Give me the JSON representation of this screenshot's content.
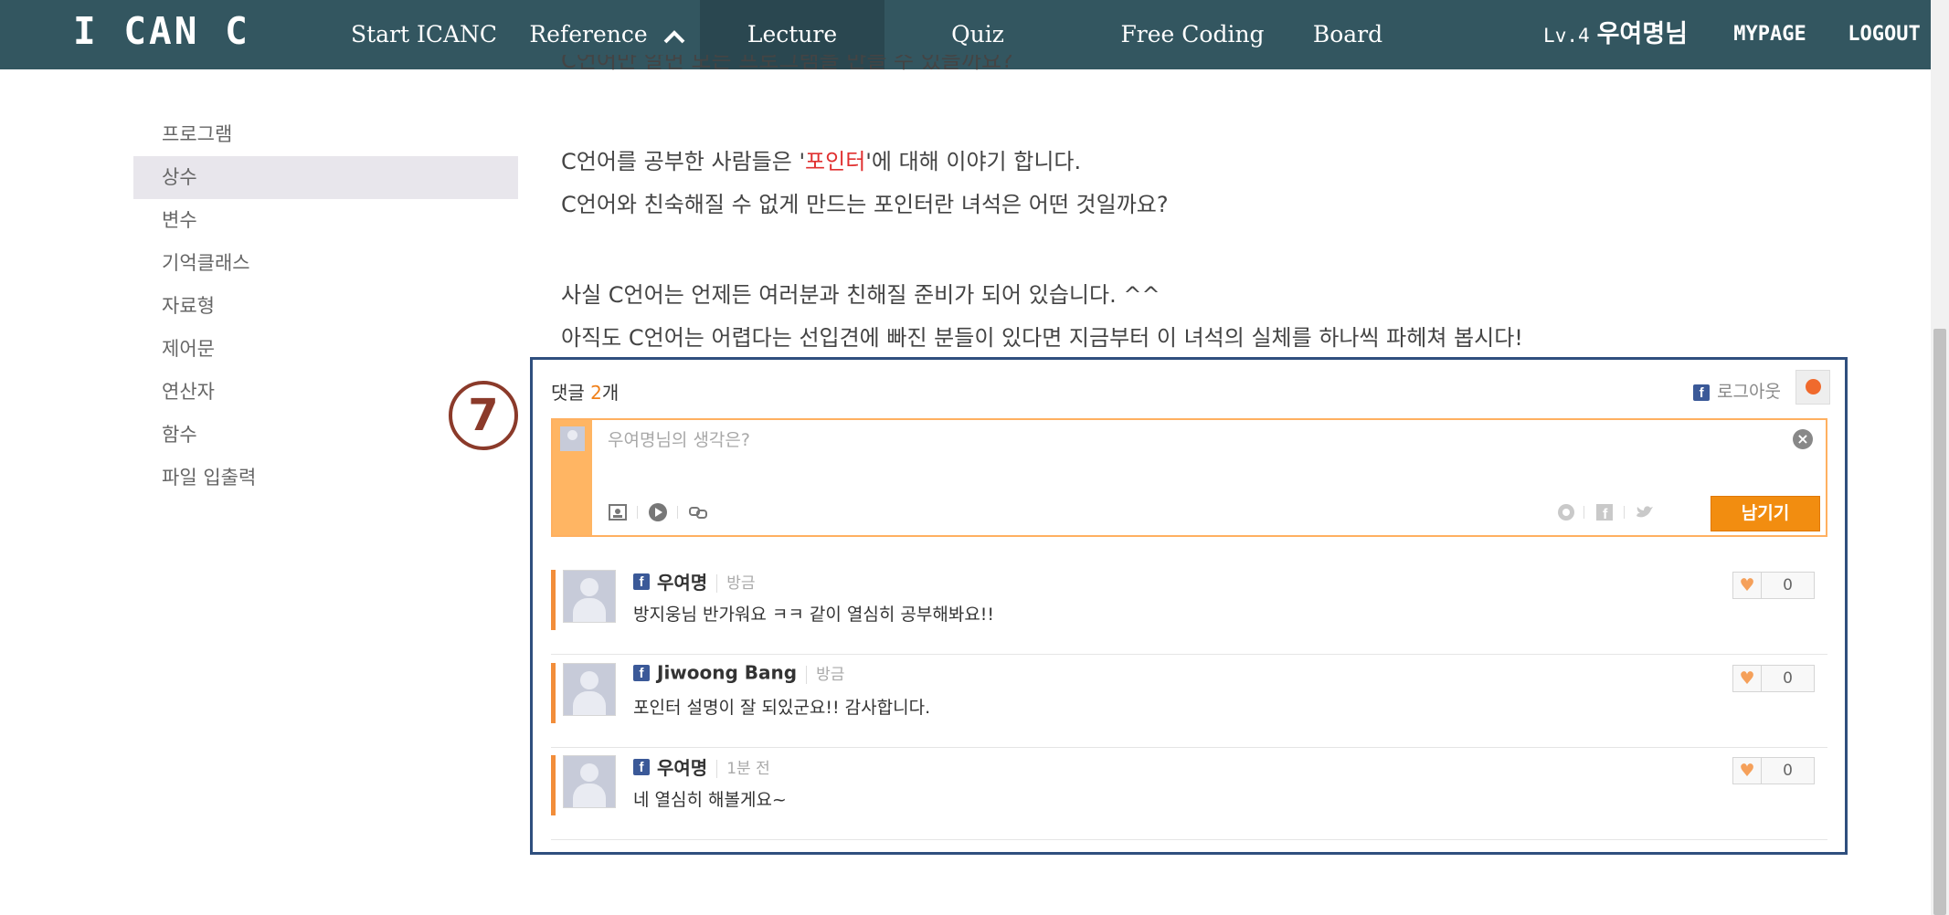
{
  "nav": {
    "logo": "I CAN C",
    "items": [
      {
        "label": "Start ICANC"
      },
      {
        "label": "Reference"
      },
      {
        "label": "Lecture"
      },
      {
        "label": "Quiz"
      },
      {
        "label": "Free Coding"
      },
      {
        "label": "Board"
      }
    ],
    "level": "Lv.4",
    "user": "우여명님",
    "mypage": "MYPAGE",
    "logout": "LOGOUT"
  },
  "sidebar": {
    "items": [
      {
        "label": "프로그램"
      },
      {
        "label": "상수"
      },
      {
        "label": "변수"
      },
      {
        "label": "기억클래스"
      },
      {
        "label": "자료형"
      },
      {
        "label": "제어문"
      },
      {
        "label": "연산자"
      },
      {
        "label": "함수"
      },
      {
        "label": "파일 입출력"
      }
    ],
    "active_index": 1
  },
  "article": {
    "line0": "C언어만 알면 모든 프로그램을 만들 수 있을까요?",
    "line1_pre": "C언어를 공부한 사람들은 '",
    "line1_hl": "포인터",
    "line1_post": "'에 대해 이야기 합니다.",
    "line2": "C언어와 친숙해질 수 없게 만드는 포인터란 녀석은 어떤 것일까요?",
    "line3": "사실 C언어는 언제든 여러분과 친해질 준비가 되어 있습니다. ^^",
    "line4": "아직도 C언어는 어렵다는 선입견에 빠진 분들이 있다면 지금부터 이 녀석의 실체를 하나씩 파헤쳐 봅시다!"
  },
  "annotation": "7",
  "comments": {
    "title_prefix": "댓글 ",
    "count": "2",
    "title_suffix": "개",
    "logout_label": "로그아웃",
    "editor": {
      "placeholder": "우여명님의 생각은?",
      "submit_label": "남기기"
    },
    "list": [
      {
        "name": "우여명",
        "time": "방금",
        "text": "방지웅님 반가워요 ㅋㅋ 같이 열심히 공부해봐요!!",
        "likes": "0"
      },
      {
        "name": "Jiwoong Bang",
        "time": "방금",
        "text": "포인터 설명이 잘 되있군요!! 감사합니다.",
        "likes": "0"
      },
      {
        "name": "우여명",
        "time": "1분 전",
        "text": "네 열심히 해볼게요~",
        "likes": "0"
      }
    ]
  },
  "colors": {
    "nav_bg": "#335660",
    "accent_orange": "#f28d10",
    "box_border": "#2f4f7e",
    "highlight_red": "#e03030"
  }
}
